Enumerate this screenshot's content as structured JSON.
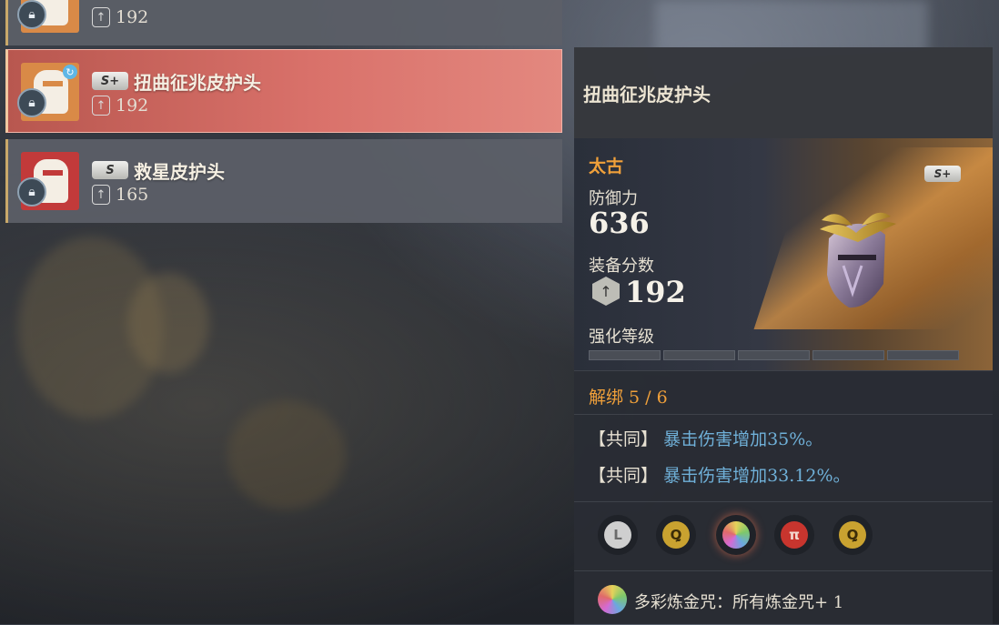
{
  "list": {
    "items": [
      {
        "name": "",
        "grade": "",
        "score": "192"
      },
      {
        "name": "扭曲征兆皮护头",
        "grade": "S+",
        "score": "192"
      },
      {
        "name": "救星皮护头",
        "grade": "S",
        "score": "165"
      }
    ]
  },
  "detail": {
    "title": "扭曲征兆皮护头",
    "rarity": "太古",
    "grade": "S+",
    "defense_label": "防御力",
    "defense_value": "636",
    "score_label": "装备分数",
    "score_value": "192",
    "enhance_label": "强化等级",
    "enhance_level": 0,
    "enhance_max": 5,
    "unbind_label": "解绑 5 / 6",
    "effects": [
      {
        "tag": "【共同】",
        "text": "暴击伤害增加35%。"
      },
      {
        "tag": "【共同】",
        "text": "暴击伤害增加33.12%。"
      }
    ],
    "runes": [
      {
        "name": "rune-white-icon",
        "color": "#cfcfcf",
        "glyph": "L"
      },
      {
        "name": "rune-yellow-icon",
        "color": "#c9a230",
        "glyph": "Ꝗ"
      },
      {
        "name": "rune-rainbow-icon",
        "color": "#e8d66a",
        "glyph": ""
      },
      {
        "name": "rune-red-icon",
        "color": "#c8352e",
        "glyph": "π"
      },
      {
        "name": "rune-yellow-icon-2",
        "color": "#c9a230",
        "glyph": "Ꝗ"
      }
    ],
    "footer_text": "多彩炼金咒：所有炼金咒+ 1"
  }
}
